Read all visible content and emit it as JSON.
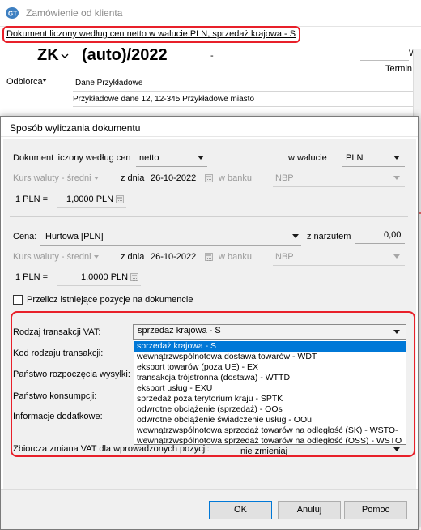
{
  "background_window": {
    "title": "Zamówienie od klienta",
    "info_bar": "Dokument liczony według cen netto w walucie PLN, sprzedaż krajowa - S",
    "doc_prefix": "ZK",
    "doc_number": "(auto)/2022",
    "dash": "-",
    "right_label_1": "Wro",
    "right_label_2": "Termin re",
    "recipient_label": "Odbiorca",
    "recipient_name": "Dane Przykładowe",
    "recipient_address": "Przykładowe dane 12, 12-345 Przykładowe miasto"
  },
  "dialog": {
    "title": "Sposób wyliczania dokumentu",
    "price_basis": {
      "label": "Dokument liczony według cen",
      "value": "netto",
      "currency_label": "w walucie",
      "currency_value": "PLN"
    },
    "rate_row_1": {
      "rate_type": "Kurs waluty - średni",
      "date_label": "z dnia",
      "date": "26-10-2022",
      "bank_label": "w banku",
      "bank": "NBP"
    },
    "conversion_1": {
      "left": "1 PLN =",
      "value": "1,0000 PLN"
    },
    "price": {
      "label": "Cena:",
      "value": "Hurtowa [PLN]",
      "markup_label": "z narzutem",
      "markup_value": "0,00"
    },
    "rate_row_2": {
      "rate_type": "Kurs waluty - średni",
      "date_label": "z dnia",
      "date": "26-10-2022",
      "bank_label": "w banku",
      "bank": "NBP"
    },
    "conversion_2": {
      "left": "1 PLN =",
      "value": "1,0000 PLN"
    },
    "recalc_checkbox_label": "Przelicz istniejące pozycje na dokumencie",
    "vat": {
      "type_label": "Rodzaj transakcji VAT:",
      "selected": "sprzedaż krajowa - S",
      "code_label": "Kod rodzaju transakcji:",
      "start_country_label": "Państwo rozpoczęcia wysyłki:",
      "consumption_country_label": "Państwo konsumpcji:",
      "additional_info_label": "Informacje dodatkowe:",
      "collective_label": "Zbiorcza zmiana VAT dla wprowadzonych pozycji:",
      "collective_value": "nie zmieniaj",
      "options": [
        "sprzedaż krajowa - S",
        "wewnątrzwspólnotowa dostawa towarów - WDT",
        "eksport towarów (poza UE) - EX",
        "transakcja trójstronna (dostawa) - WTTD",
        "eksport usług - EXU",
        "sprzedaż poza terytorium kraju - SPTK",
        "odwrotne obciążenie (sprzedaż) - OOs",
        "odwrotne obciążenie świadczenie usług - OOu",
        "wewnątrzwspólnotowa sprzedaż towarów na odległość (SK) - WSTO-",
        "wewnątrzwspólnotowa sprzedaż towarów na odległość (OSS) - WSTO"
      ]
    },
    "buttons": {
      "ok": "OK",
      "cancel": "Anuluj",
      "help": "Pomoc"
    }
  },
  "colors": {
    "highlight": "#e8202a",
    "selection": "#0078d7",
    "panel": "#f0f0f0"
  }
}
